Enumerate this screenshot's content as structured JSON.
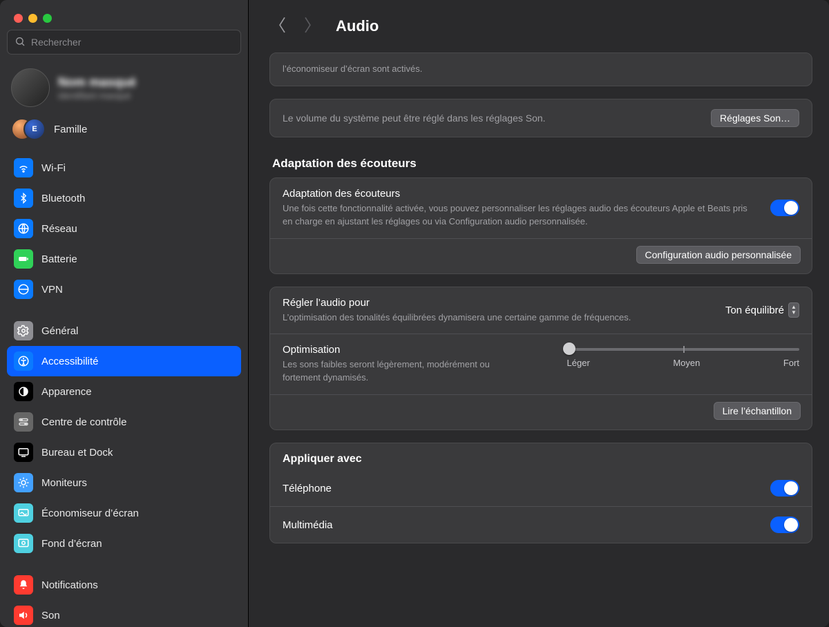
{
  "window": {
    "title": "Audio"
  },
  "search": {
    "placeholder": "Rechercher"
  },
  "user": {
    "name": "Nom masqué",
    "sub": "identifiant masqué"
  },
  "family": {
    "label": "Famille",
    "badge_letter": "E"
  },
  "sidebar": {
    "items": [
      {
        "label": "Wi-Fi"
      },
      {
        "label": "Bluetooth"
      },
      {
        "label": "Réseau"
      },
      {
        "label": "Batterie"
      },
      {
        "label": "VPN"
      },
      {
        "label": "Général"
      },
      {
        "label": "Accessibilité"
      },
      {
        "label": "Apparence"
      },
      {
        "label": "Centre de contrôle"
      },
      {
        "label": "Bureau et Dock"
      },
      {
        "label": "Moniteurs"
      },
      {
        "label": "Économiseur d’écran"
      },
      {
        "label": "Fond d’écran"
      },
      {
        "label": "Notifications"
      },
      {
        "label": "Son"
      }
    ]
  },
  "top_note": "l’économiseur d’écran sont activés.",
  "volume_row": {
    "text": "Le volume du système peut être réglé dans les réglages Son.",
    "button": "Réglages Son…"
  },
  "headphones": {
    "section_title": "Adaptation des écouteurs",
    "toggle_label": "Adaptation des écouteurs",
    "toggle_desc": "Une fois cette fonctionnalité activée, vous pouvez personnaliser les réglages audio des écouteurs Apple et Beats pris en charge en ajustant les réglages ou via Configuration audio personnalisée.",
    "config_button": "Configuration audio personnalisée",
    "tune_label": "Régler l’audio pour",
    "tune_desc": "L’optimisation des tonalités équilibrées dynamisera une certaine gamme de fréquences.",
    "tune_value": "Ton équilibré",
    "optim_label": "Optimisation",
    "optim_desc": "Les sons faibles seront légèrement, modérément ou fortement dynamisés.",
    "slider": {
      "min_label": "Léger",
      "mid_label": "Moyen",
      "max_label": "Fort",
      "value_pct": 1
    },
    "play_button": "Lire l’échantillon"
  },
  "apply": {
    "section_title": "Appliquer avec",
    "phone_label": "Téléphone",
    "media_label": "Multimédia"
  }
}
